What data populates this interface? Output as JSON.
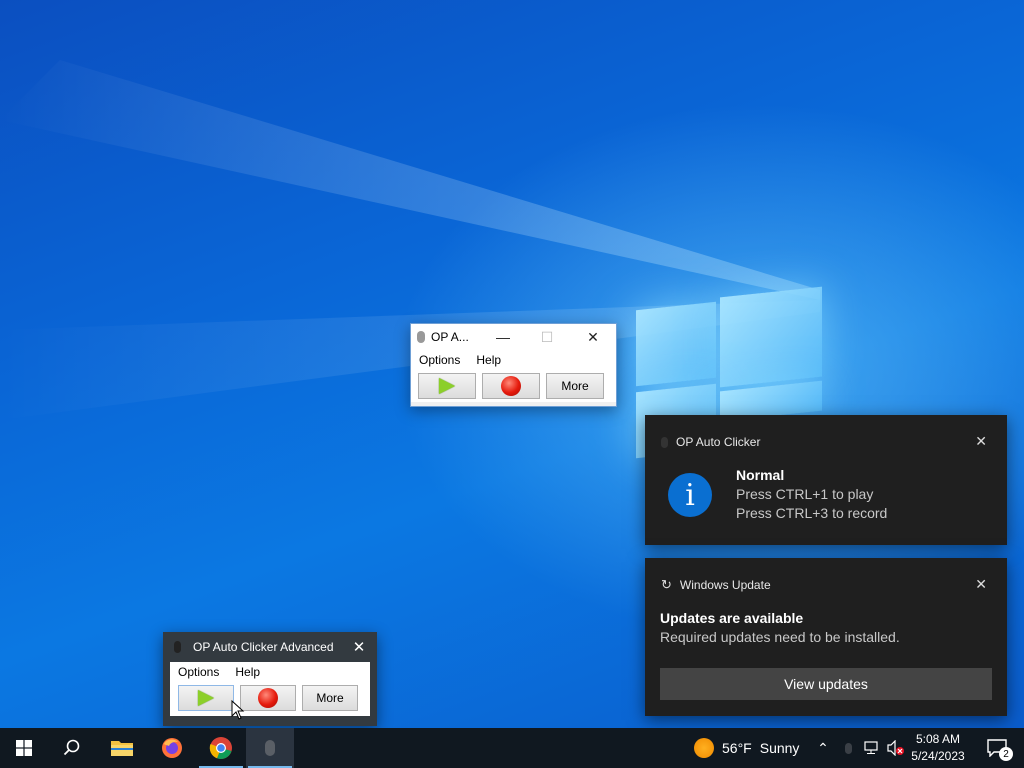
{
  "small_window": {
    "title": "OP A...",
    "menus": [
      "Options",
      "Help"
    ],
    "more_label": "More"
  },
  "dark_window": {
    "title": "OP Auto Clicker Advanced",
    "menus": [
      "Options",
      "Help"
    ],
    "more_label": "More"
  },
  "toast_clicker": {
    "app": "OP Auto Clicker",
    "title": "Normal",
    "line1": "Press CTRL+1 to play",
    "line2": "Press CTRL+3 to record",
    "icon": "info-icon"
  },
  "toast_update": {
    "app": "Windows Update",
    "title": "Updates are available",
    "body": "Required updates need to be installed.",
    "button": "View updates"
  },
  "taskbar": {
    "weather_temp": "56°F",
    "weather_desc": "Sunny",
    "time": "5:08 AM",
    "date": "5/24/2023",
    "notification_count": "2"
  },
  "colors": {
    "accent": "#0078d7",
    "taskbar_bg": "#101820",
    "toast_bg": "#1f1f1f"
  }
}
